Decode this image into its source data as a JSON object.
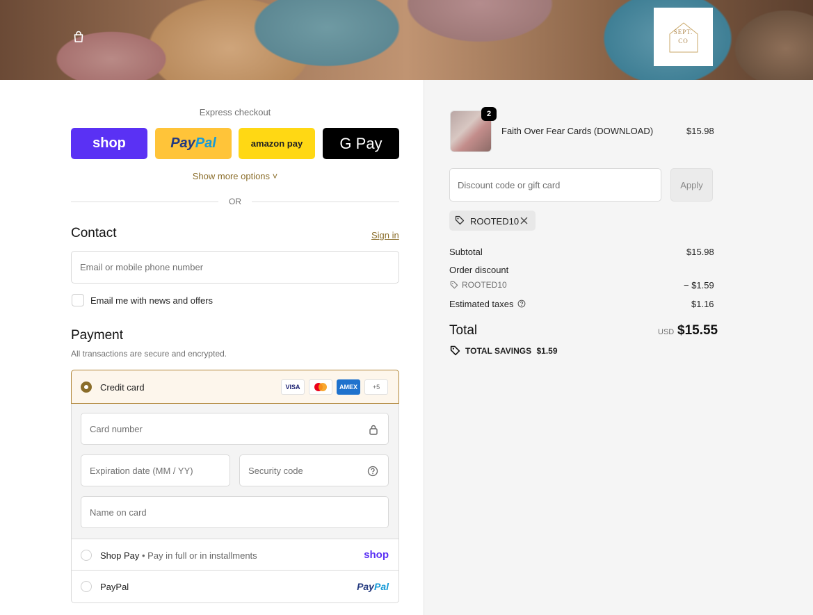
{
  "header": {
    "logo_line1": "SEPT.",
    "logo_line2": "CO"
  },
  "express": {
    "label": "Express checkout",
    "shop_label": "shop",
    "paypal_a": "Pay",
    "paypal_b": "Pal",
    "amazon_label": "amazon pay",
    "gpay_label": "G Pay",
    "more_options": "Show more options ˅",
    "or": "OR"
  },
  "contact": {
    "title": "Contact",
    "signin": "Sign in",
    "email_placeholder": "Email or mobile phone number",
    "news_label": "Email me with news and offers"
  },
  "payment": {
    "title": "Payment",
    "subtitle": "All transactions are secure and encrypted.",
    "credit_card_label": "Credit card",
    "card_logos": [
      "VISA",
      "MC",
      "AMEX",
      "+5"
    ],
    "card_number": "Card number",
    "expiration": "Expiration date (MM / YY)",
    "security": "Security code",
    "name_on_card": "Name on card",
    "shop_pay_label": "Shop Pay",
    "shop_pay_sub": "• Pay in full or in installments",
    "shop_pay_logo": "shop",
    "paypal_label": "PayPal",
    "paypal_logo_a": "Pay",
    "paypal_logo_b": "Pal"
  },
  "order": {
    "quantity": "2",
    "item_name": "Faith Over Fear Cards (DOWNLOAD)",
    "item_price": "$15.98",
    "discount_placeholder": "Discount code or gift card",
    "apply": "Apply",
    "code": "ROOTED10",
    "subtotal_label": "Subtotal",
    "subtotal": "$15.98",
    "order_discount_label": "Order discount",
    "discount_code": "ROOTED10",
    "discount_value": "− $1.59",
    "taxes_label": "Estimated taxes",
    "taxes": "$1.16",
    "total_label": "Total",
    "currency": "USD",
    "total": "$15.55",
    "savings_label": "TOTAL SAVINGS",
    "savings": "$1.59"
  },
  "colors": {
    "accent": "#8a6d2a",
    "shop": "#5a31f4",
    "paypal": "#ffc439",
    "amazon": "#ffd814"
  }
}
